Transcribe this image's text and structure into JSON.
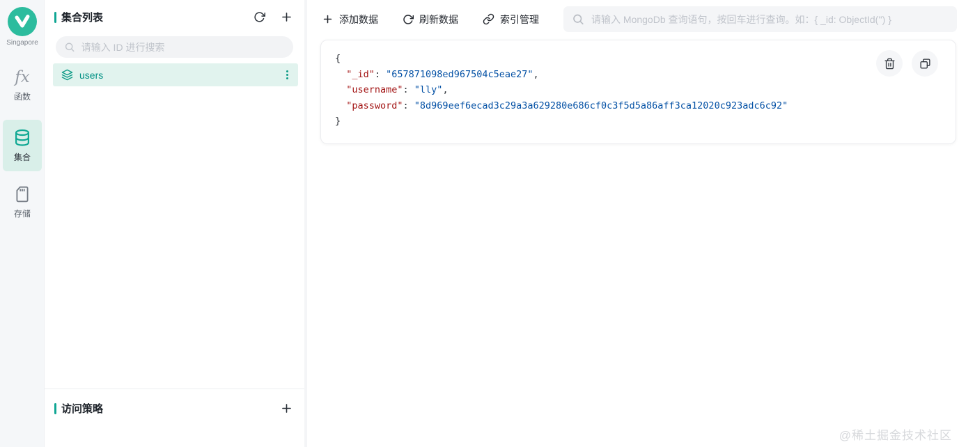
{
  "rail": {
    "region_label": "Singapore",
    "items": [
      {
        "id": "functions",
        "label": "函数"
      },
      {
        "id": "collections",
        "label": "集合"
      },
      {
        "id": "storage",
        "label": "存储"
      }
    ]
  },
  "sidebar": {
    "header": {
      "title": "集合列表"
    },
    "search_placeholder": "请输入 ID 进行搜索",
    "collections": [
      {
        "name": "users",
        "active": true
      }
    ],
    "footer": {
      "title": "访问策略"
    }
  },
  "toolbar": {
    "add_label": "添加数据",
    "refresh_label": "刷新数据",
    "index_label": "索引管理",
    "search_placeholder": "请输入 MongoDb 查询语句，按回车进行查询。如：{ _id: ObjectId('') }"
  },
  "document": {
    "open_brace": "{",
    "close_brace": "}",
    "punctuation": {
      "colon": ": "
    },
    "fields": [
      {
        "key": "\"_id\"",
        "value": "\"657871098ed967504c5eae27\"",
        "comma": ","
      },
      {
        "key": "\"username\"",
        "value": "\"lly\"",
        "comma": ","
      },
      {
        "key": "\"password\"",
        "value": "\"8d969eef6ecad3c29a3a629280e686cf0c3f5d5a86aff3ca12020c923adc6c92\"",
        "comma": ""
      }
    ]
  },
  "watermark": "@稀土掘金技术社区",
  "colors": {
    "accent": "#10a694",
    "accent_bg": "#e1f3ee",
    "key": "#a31515",
    "value": "#0451a5"
  }
}
